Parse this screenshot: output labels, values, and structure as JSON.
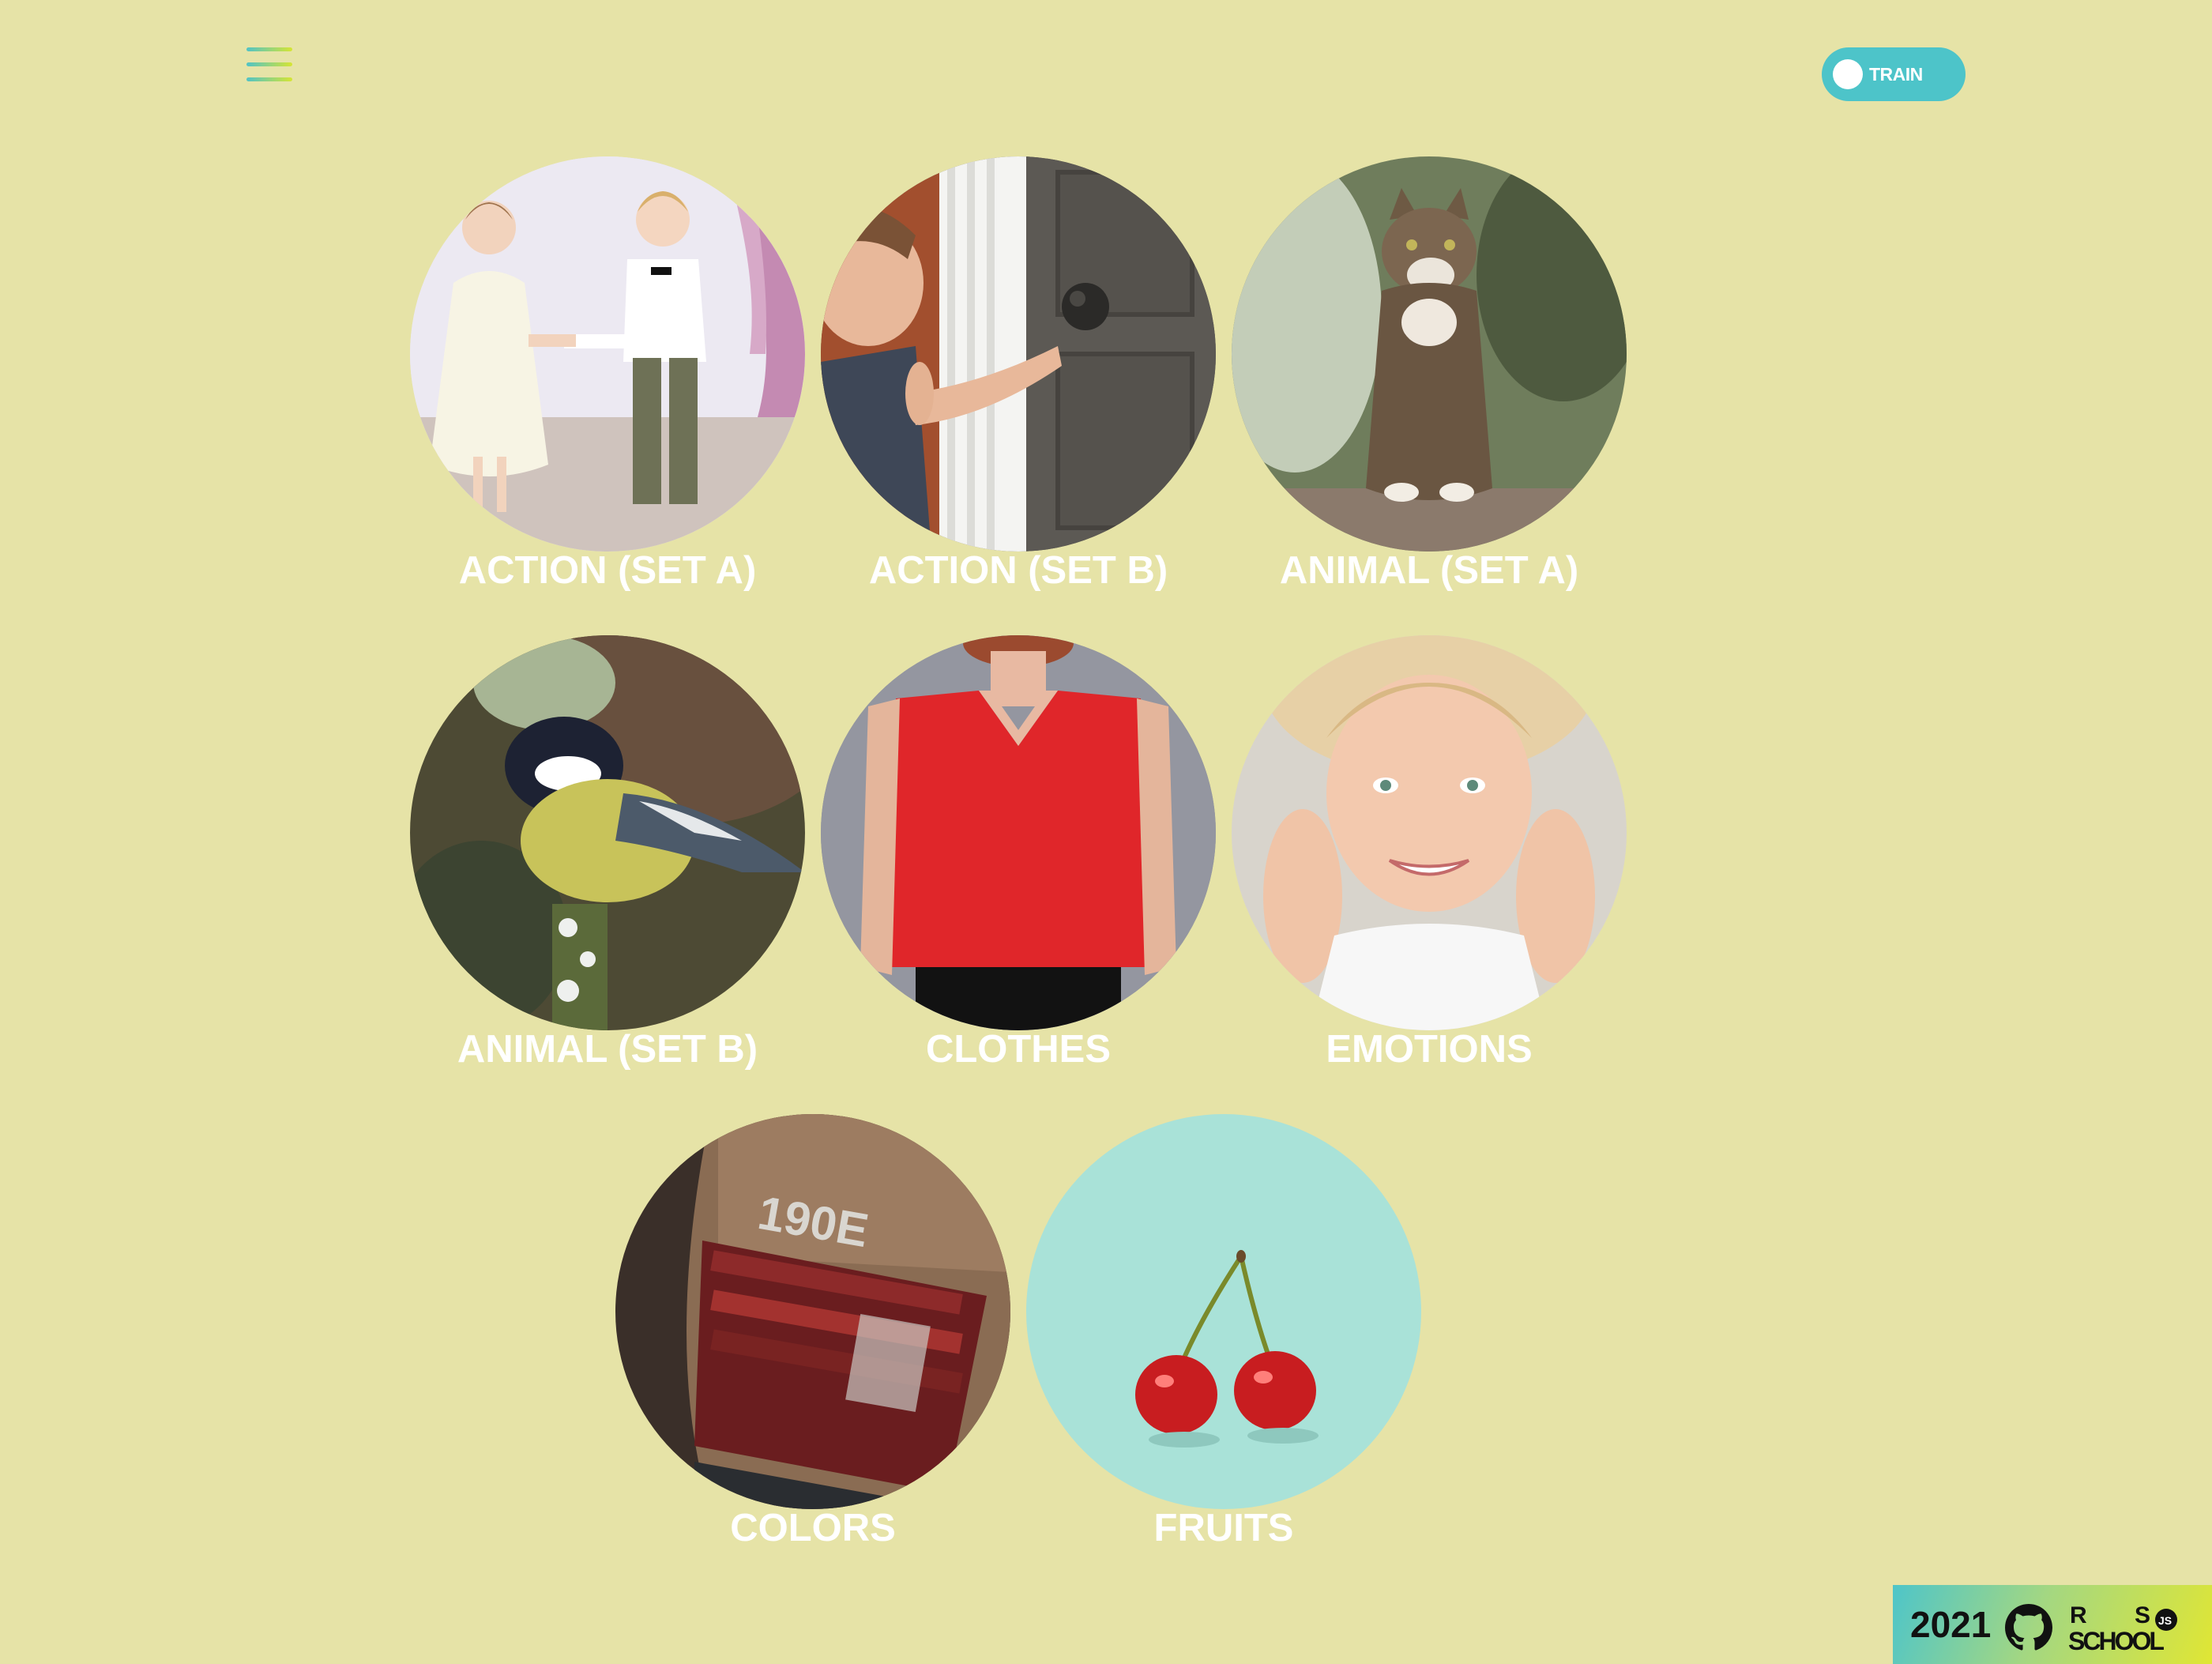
{
  "header": {
    "menu_icon": "hamburger-icon",
    "toggle": {
      "label": "TRAIN",
      "state": "train"
    }
  },
  "categories": [
    {
      "title": "ACTION (SET A)"
    },
    {
      "title": "ACTION (SET B)"
    },
    {
      "title": "ANIMAL (SET A)"
    },
    {
      "title": "ANIMAL (SET B)"
    },
    {
      "title": "CLOTHES"
    },
    {
      "title": "EMOTIONS"
    },
    {
      "title": "COLORS"
    },
    {
      "title": "FRUITS"
    }
  ],
  "footer": {
    "year": "2021",
    "github_icon": "github-icon",
    "logo": "rs-school-js-logo"
  },
  "colors": {
    "background": "#e6e3a7",
    "accent": "#4dc4c9",
    "title_text": "#ffffff"
  }
}
